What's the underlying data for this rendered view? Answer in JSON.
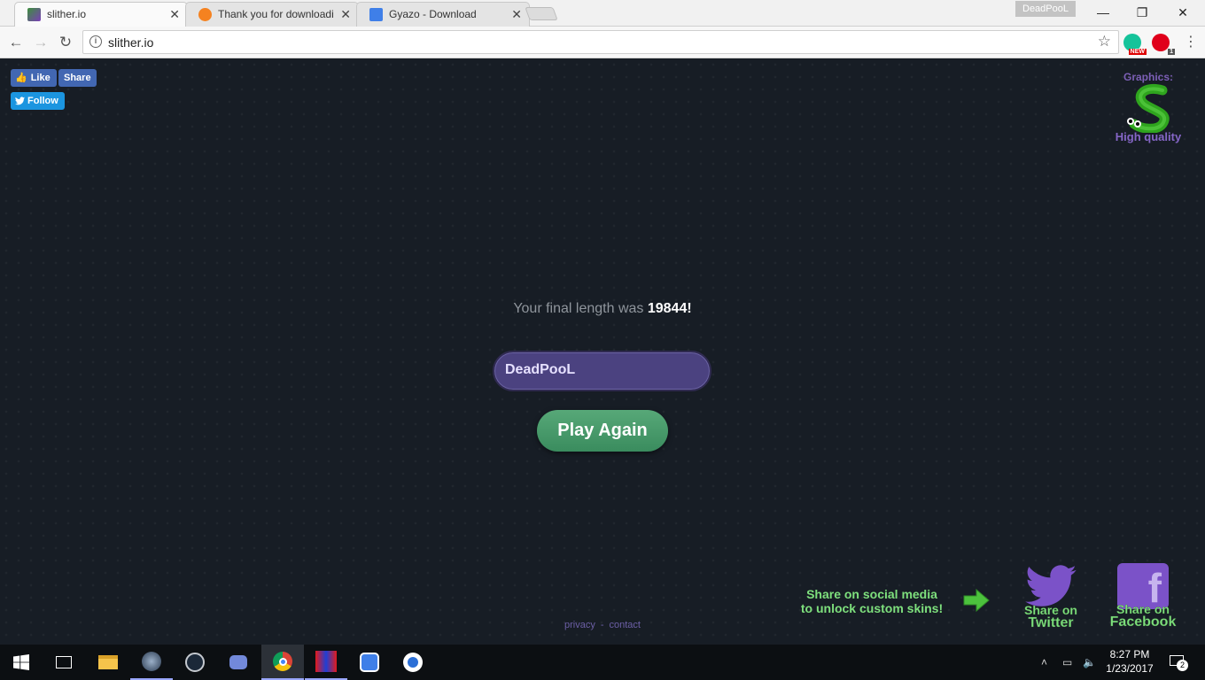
{
  "browser": {
    "tabs": [
      {
        "title": "slither.io",
        "active": true
      },
      {
        "title": "Thank you for downloadi",
        "active": false
      },
      {
        "title": "Gyazo - Download",
        "active": false
      }
    ],
    "profile_name": "DeadPooL",
    "address": "slither.io",
    "extensions": [
      {
        "name": "grammarly-extension",
        "badge": "NEW",
        "color": "#15c39a"
      },
      {
        "name": "adblock-extension",
        "badge": "1",
        "color": "#e0001b"
      }
    ]
  },
  "social": {
    "like_label": "Like",
    "share_label": "Share",
    "follow_label": "Follow"
  },
  "graphics": {
    "label": "Graphics:",
    "quality": "High quality"
  },
  "game_over": {
    "final_prefix": "Your final length was ",
    "final_length": "19844",
    "final_suffix": "!",
    "nickname": "DeadPooL",
    "play_again_label": "Play Again"
  },
  "share_promo": {
    "line1": "Share on social media",
    "line2": "to unlock custom skins!",
    "twitter_l1": "Share on",
    "twitter_l2": "Twitter",
    "facebook_l1": "Share on",
    "facebook_l2": "Facebook"
  },
  "footer": {
    "privacy": "privacy",
    "separator": "-",
    "contact": "contact"
  },
  "taskbar": {
    "apps": [
      "start-icon",
      "task-view-icon",
      "file-explorer-icon",
      "app-icon",
      "steam-icon",
      "discord-icon",
      "chrome-icon",
      "asus-icon",
      "gyazo-icon",
      "app-icon-2"
    ],
    "time": "8:27 PM",
    "date": "1/23/2017",
    "notifications": "2"
  },
  "colors": {
    "page_bg": "#171d25",
    "nickname_bg": "#4b4280",
    "play_button": "#4a9b6c",
    "promo_green": "#7ee07d",
    "footer_link": "#6c5fa6"
  }
}
